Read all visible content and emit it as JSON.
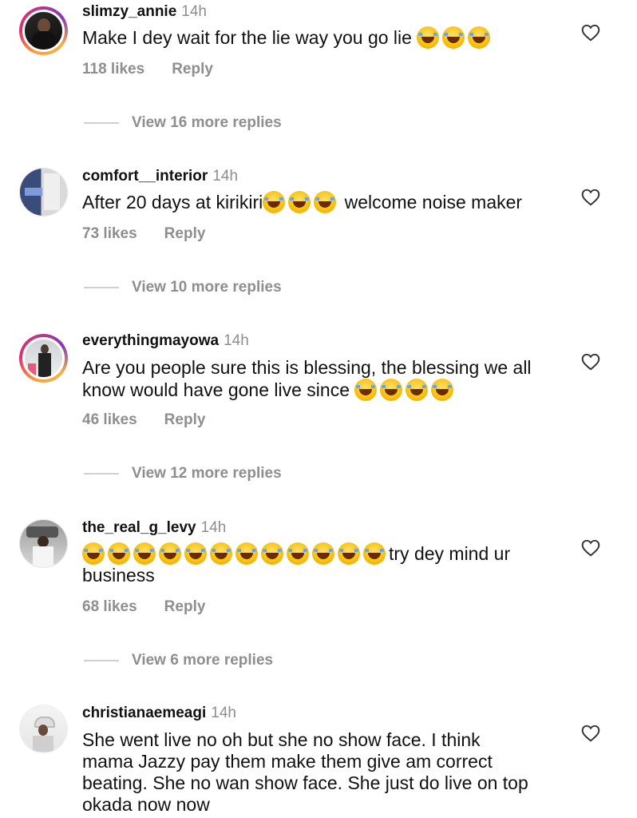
{
  "comments": [
    {
      "username": "slimzy_annie",
      "time": "14h",
      "text_before": "Make I dey wait for the lie way you go lie ",
      "emoji_count": 3,
      "text_after": "",
      "likes": "118 likes",
      "reply": "Reply",
      "view_more": "View 16 more replies",
      "avatar_ring": true
    },
    {
      "username": "comfort__interior",
      "time": "14h",
      "text_before": "After 20 days at kirikiri",
      "emoji_count": 3,
      "text_after": " welcome noise maker",
      "likes": "73 likes",
      "reply": "Reply",
      "view_more": "View 10 more replies",
      "avatar_ring": false
    },
    {
      "username": "everythingmayowa",
      "time": "14h",
      "text_before": "Are you people sure this is blessing, the blessing we all know would have gone live since ",
      "emoji_count": 4,
      "text_after": "",
      "likes": "46 likes",
      "reply": "Reply",
      "view_more": "View 12 more replies",
      "avatar_ring": true
    },
    {
      "username": "the_real_g_levy",
      "time": "14h",
      "text_before": "",
      "emoji_count": 12,
      "text_after": "try dey mind ur business",
      "likes": "68 likes",
      "reply": "Reply",
      "view_more": "View 6 more replies",
      "avatar_ring": false
    },
    {
      "username": "christianaemeagi",
      "time": "14h",
      "text_before": "She went live no oh but she no show face. I think mama Jazzy pay them make them give am correct beating. She no wan show face. She just do live on top okada now now",
      "emoji_count": 0,
      "text_after": "",
      "likes": "",
      "reply": "",
      "view_more": "",
      "avatar_ring": false
    }
  ],
  "icons": {
    "like": "heart-outline-icon",
    "emoji": "face-with-tears-of-joy-emoji"
  }
}
